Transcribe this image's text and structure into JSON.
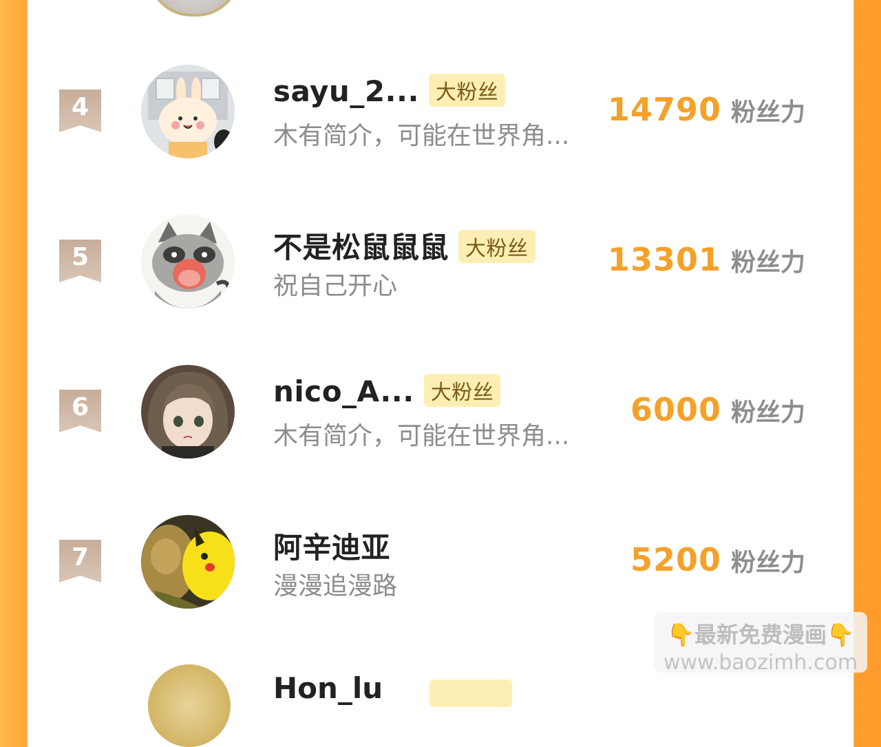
{
  "rows": [
    {
      "rank": "4",
      "name": "sayu_2...",
      "badge": "大粉丝",
      "desc": "木有简介，可能在世界角...",
      "score": "14790",
      "unit": "粉丝力",
      "avatar_icon": "bunny-avatar-icon"
    },
    {
      "rank": "5",
      "name": "不是松鼠鼠鼠",
      "badge": "大粉丝",
      "desc": "祝自己开心",
      "score": "13301",
      "unit": "粉丝力",
      "avatar_icon": "raccoon-avatar-icon"
    },
    {
      "rank": "6",
      "name": "nico_A...",
      "badge": "大粉丝",
      "desc": "木有简介，可能在世界角...",
      "score": "6000",
      "unit": "粉丝力",
      "avatar_icon": "anime-boy-avatar-icon"
    },
    {
      "rank": "7",
      "name": "阿辛迪亚",
      "badge": "",
      "desc": "漫漫追漫路",
      "score": "5200",
      "unit": "粉丝力",
      "avatar_icon": "cat-pikachu-avatar-icon"
    }
  ],
  "watermark": {
    "line1": "最新免费漫画",
    "line2": "www.baozimh.com",
    "hand": "👇"
  },
  "colors": {
    "accent": "#f4a12a",
    "badge_bg": "#fdefb3",
    "rank_bg": "#c7ad99",
    "side": "#ffa737"
  },
  "partial_row": {
    "name": "Hon_lu"
  }
}
